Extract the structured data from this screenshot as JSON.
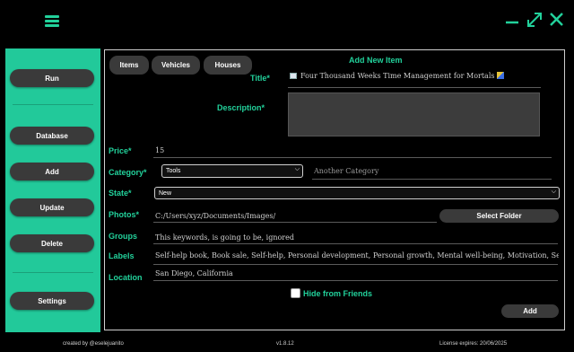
{
  "sidebar": {
    "run": "Run",
    "database": "Database",
    "add": "Add",
    "update": "Update",
    "delete": "Delete",
    "settings": "Settings"
  },
  "tabs": [
    "Items",
    "Vehicles",
    "Houses"
  ],
  "form": {
    "heading": "Add New Item",
    "title_label": "Title*",
    "title_value": "Four Thousand Weeks Time Management for Mortals",
    "description_label": "Description*",
    "description_value": "",
    "price_label": "Price*",
    "price_value": "15",
    "category_label": "Category*",
    "category_value": "Tools",
    "category_alt_placeholder": "Another Category",
    "state_label": "State*",
    "state_value": "New",
    "photos_label": "Photos*",
    "photos_value": "C:/Users/xyz/Documents/Images/",
    "select_folder": "Select Folder",
    "groups_label": "Groups",
    "groups_value": "This keywords, is going to be, ignored",
    "labels_label": "Labels",
    "labels_value": "Self-help book, Book sale, Self-help, Personal development, Personal growth, Mental well-being, Motivation, Self-improvement, ...",
    "location_label": "Location",
    "location_value": "San Diego, California",
    "hide_label": "Hide from Friends",
    "hide_checked": false,
    "add_button": "Add"
  },
  "footer": {
    "created_by": "created by @eselejuanito",
    "version": "v1.8.12",
    "license": "License expires: 20/06/2025"
  },
  "colors": {
    "accent": "#22c99a",
    "background": "#000000",
    "button": "#3a3a3a"
  }
}
